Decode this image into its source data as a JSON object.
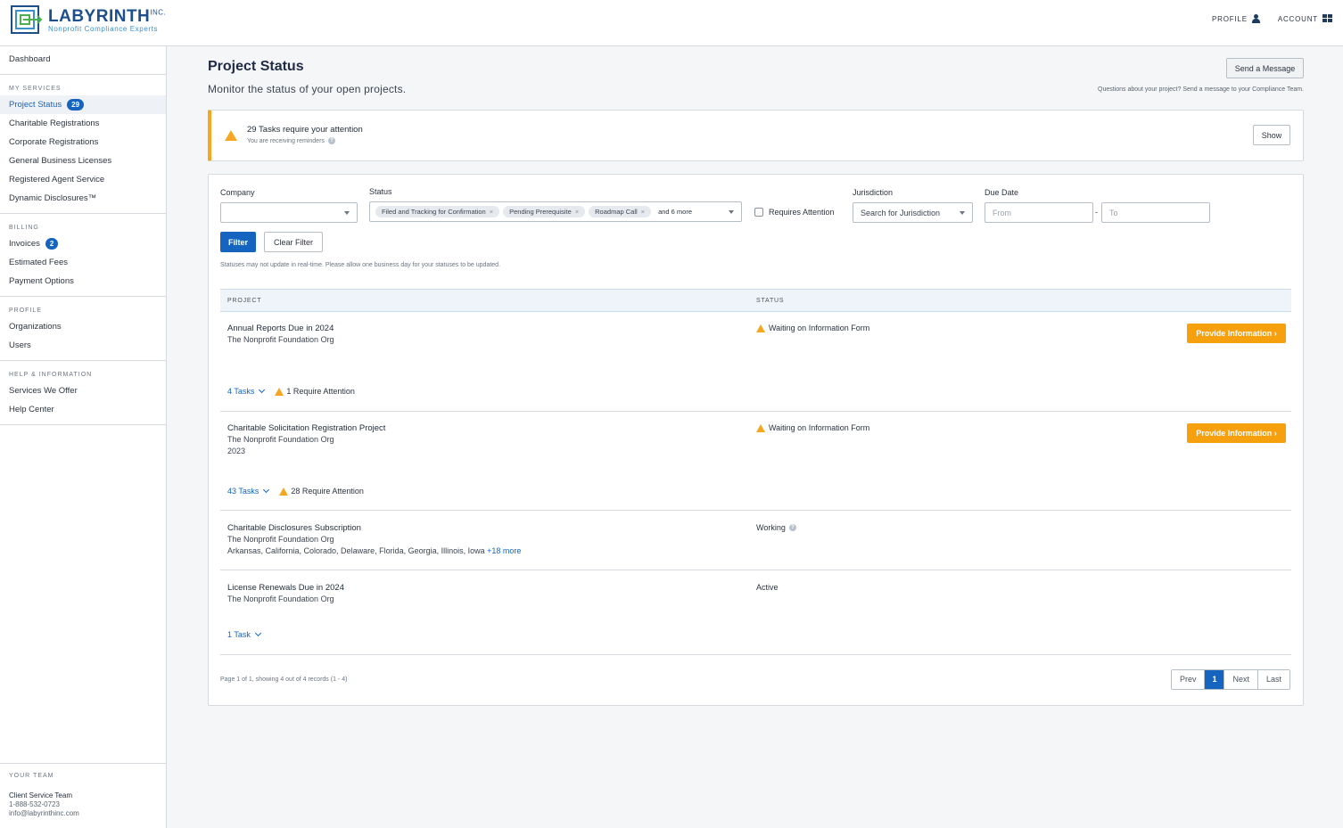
{
  "header": {
    "logo_name": "LABYRINTH",
    "logo_suffix": "INC.",
    "logo_tagline": "Nonprofit Compliance Experts",
    "profile_label": "PROFILE",
    "account_label": "ACCOUNT"
  },
  "sidebar": {
    "dashboard": "Dashboard",
    "my_services_head": "MY SERVICES",
    "project_status": "Project Status",
    "project_status_badge": "29",
    "charitable": "Charitable Registrations",
    "corporate": "Corporate Registrations",
    "licenses": "General Business Licenses",
    "agent": "Registered Agent Service",
    "disclosures": "Dynamic Disclosures™",
    "billing_head": "BILLING",
    "invoices": "Invoices",
    "invoices_badge": "2",
    "fees": "Estimated Fees",
    "payment": "Payment Options",
    "profile_head": "PROFILE",
    "orgs": "Organizations",
    "users": "Users",
    "help_head": "HELP & INFORMATION",
    "services": "Services We Offer",
    "help_center": "Help Center",
    "team_head": "YOUR TEAM",
    "team_name": "Client Service Team",
    "team_phone": "1-888-532-0723",
    "team_email": "info@labyrinthinc.com"
  },
  "main": {
    "title": "Project Status",
    "subtitle": "Monitor the status of your open projects.",
    "send_button": "Send a Message",
    "send_note": "Questions about your project? Send a message to your Compliance Team."
  },
  "alert": {
    "count": "29 Tasks",
    "text": " require your attention",
    "sub": "You are receiving reminders",
    "show_button": "Show"
  },
  "filters": {
    "company_label": "Company",
    "status_label": "Status",
    "chips": [
      "Filed and Tracking for Confirmation",
      "Pending Prerequisite",
      "Roadmap Call"
    ],
    "more": "and 6 more",
    "requires_attention": "Requires Attention",
    "jurisdiction_label": "Jurisdiction",
    "jurisdiction_placeholder": "Search for Jurisdiction",
    "due_label": "Due Date",
    "from_placeholder": "From",
    "to_placeholder": "To",
    "dash": "-",
    "filter_button": "Filter",
    "clear_button": "Clear Filter",
    "note": "Statuses may not update in real-time. Please allow one business day for your statuses to be updated."
  },
  "table": {
    "col_project": "PROJECT",
    "col_status": "STATUS",
    "rows": [
      {
        "name": "Annual Reports Due in 2024",
        "org": "The Nonprofit Foundation Org",
        "status": "Waiting on Information Form",
        "action": "Provide Information ›",
        "tasks": "4 Tasks",
        "attention": "1 Require Attention"
      },
      {
        "name": "Charitable Solicitation Registration Project",
        "org": "The Nonprofit Foundation Org",
        "year": "2023",
        "status": "Waiting on Information Form",
        "action": "Provide Information ›",
        "tasks": "43 Tasks",
        "attention": "28 Require Attention"
      },
      {
        "name": "Charitable Disclosures Subscription",
        "org": "The Nonprofit Foundation Org",
        "states": "Arkansas, California, Colorado, Delaware, Florida, Georgia, Illinois, Iowa",
        "states_more": "+18 more",
        "status": "Working"
      },
      {
        "name": "License Renewals Due in 2024",
        "org": "The Nonprofit Foundation Org",
        "status": "Active",
        "tasks": "1 Task"
      }
    ]
  },
  "pagination": {
    "info": "Page 1 of 1, showing 4 out of 4 records (1 - 4)",
    "prev": "Prev",
    "current": "1",
    "next": "Next",
    "last": "Last"
  },
  "colors": {
    "brand": "#1565c0",
    "warning": "#f5a623",
    "action": "#f5a00c"
  }
}
